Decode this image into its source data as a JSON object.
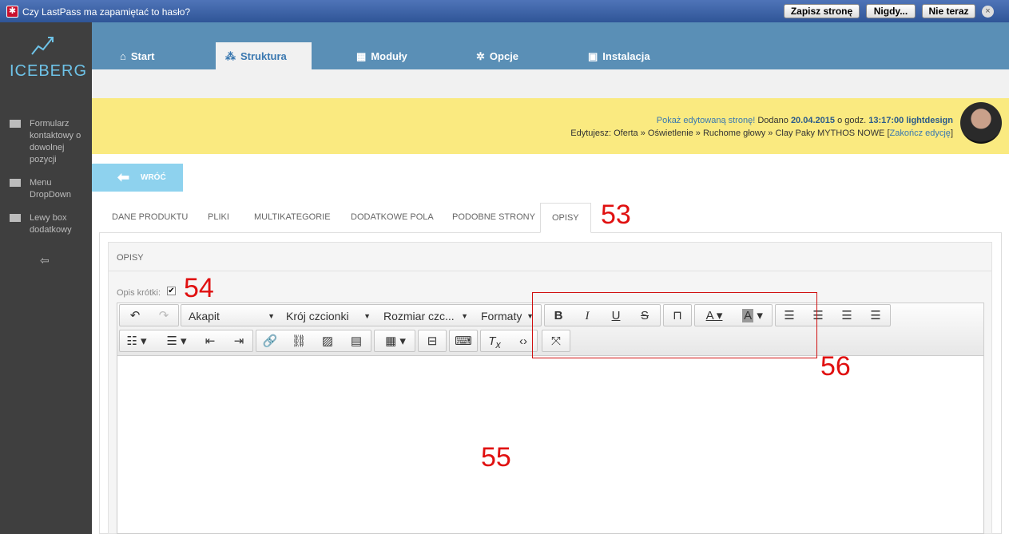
{
  "lastpass": {
    "question": "Czy LastPass ma zapamiętać to hasło?",
    "save": "Zapisz stronę",
    "never": "Nigdy...",
    "not_now": "Nie teraz",
    "close": "×"
  },
  "logo": "ICEBERG",
  "sidebar": {
    "items": [
      {
        "label": "Formularz kontaktowy o dowolnej pozycji",
        "icon": "mail-icon"
      },
      {
        "label": "Menu DropDown",
        "icon": "menu-icon"
      },
      {
        "label": "Lewy box dodatkowy",
        "icon": "box-icon"
      }
    ],
    "collapse": "⇦"
  },
  "nav": {
    "items": [
      {
        "label": "Start",
        "icon": "home-icon",
        "glyph": "⌂"
      },
      {
        "label": "Struktura",
        "icon": "sitemap-icon",
        "glyph": "⁂",
        "active": true
      },
      {
        "label": "Moduły",
        "icon": "modules-icon",
        "glyph": "▦"
      },
      {
        "label": "Opcje",
        "icon": "gear-icon",
        "glyph": "✲"
      },
      {
        "label": "Instalacja",
        "icon": "install-icon",
        "glyph": "▣"
      }
    ]
  },
  "info": {
    "show_link": "Pokaż edytowaną stronę!",
    "added": "Dodano",
    "date": "20.04.2015",
    "at": "o godz.",
    "time": "13:17:00",
    "user": "lightdesign",
    "editing_label": "Edytujesz:",
    "breadcrumb": "Oferta » Oświetlenie » Ruchome głowy » Clay Paky MYTHOS NOWE",
    "end_open": "[",
    "end_link": "Zakończ edycję",
    "end_close": "]"
  },
  "back_label": "WRÓĆ",
  "tabs": [
    "DANE PRODUKTU",
    "PLIKI",
    "MULTIKATEGORIE",
    "DODATKOWE POLA",
    "PODOBNE STRONY",
    "OPISY"
  ],
  "panel_title": "OPISY",
  "short_label": "Opis krótki:",
  "checkbox_mark": "✔",
  "toolbar": {
    "paragraph": "Akapit",
    "font": "Krój czcionki",
    "size": "Rozmiar czc...",
    "formats": "Formaty"
  },
  "annotations": {
    "n53": "53",
    "n54": "54",
    "n55": "55",
    "n56": "56"
  },
  "colors": {
    "accent": "#5a8fb6",
    "annotation": "#e01010",
    "info_bar": "#faea80",
    "logo": "#6ec3e8"
  }
}
